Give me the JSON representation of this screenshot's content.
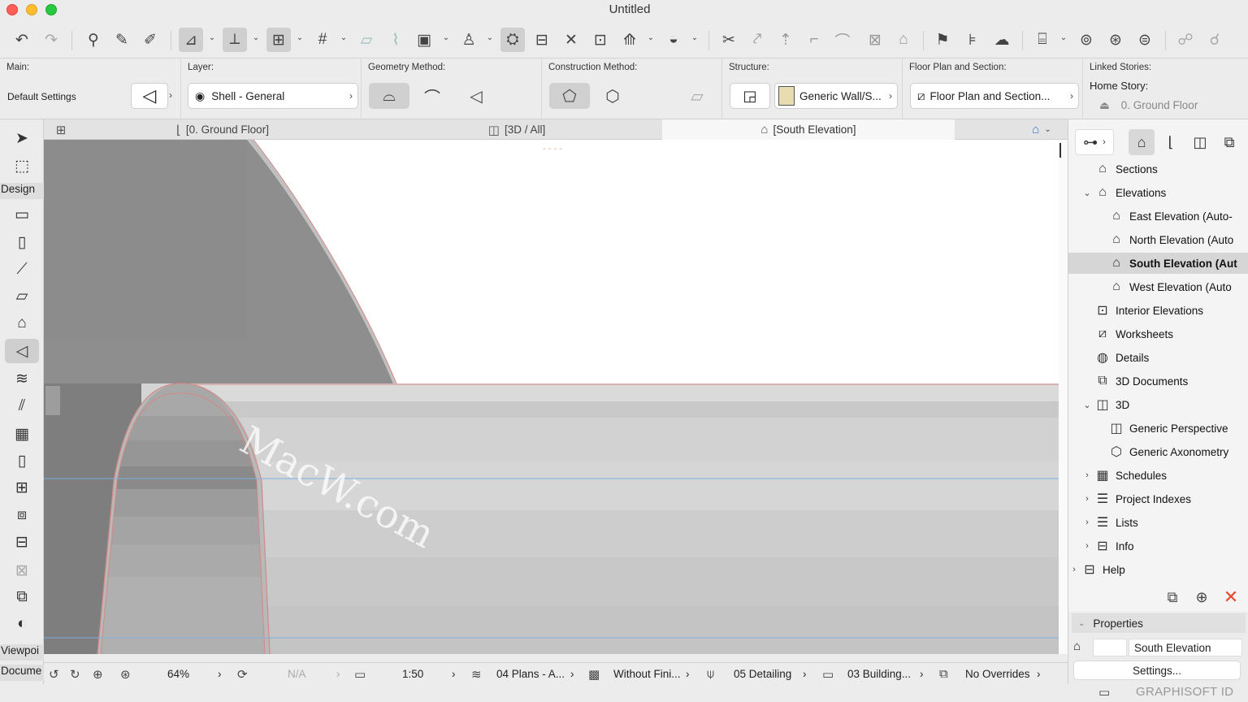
{
  "window": {
    "title": "Untitled"
  },
  "toolbar": {
    "icons": [
      "undo-icon",
      "redo-icon",
      "find-select-icon",
      "eyedropper-icon",
      "inject-icon",
      "guide-lines-icon",
      "snap-guides-icon",
      "grid-snap-icon",
      "grid-icon",
      "trace-icon",
      "split-icon",
      "layout-icon",
      "element-info-icon",
      "renovation-icon",
      "dimension-icon",
      "intersect-icon",
      "group-icon",
      "suspend-groups-icon",
      "solid-ops-icon",
      "cut-icon",
      "offset-icon",
      "elevate-icon",
      "corner-icon",
      "fillet-icon",
      "resize-icon",
      "roof-icon",
      "flag-icon",
      "teamwork-icon",
      "publish-icon",
      "reserve-icon",
      "send-receive-icon",
      "compare-icon",
      "issue-icon",
      "bim-icon",
      "cloud-icon"
    ]
  },
  "infobox": {
    "main_label": "Main:",
    "main_value": "Default Settings",
    "layer_label": "Layer:",
    "layer_value": "Shell - General",
    "geometry_label": "Geometry Method:",
    "construction_label": "Construction Method:",
    "structure_label": "Structure:",
    "structure_value": "Generic Wall/S...",
    "floorplan_label": "Floor Plan and Section:",
    "floorplan_value": "Floor Plan and Section...",
    "linked_label": "Linked Stories:",
    "home_story_label": "Home Story:",
    "home_story_value": "0. Ground Floor"
  },
  "toolbox": {
    "design_label": "Design",
    "viewpoint_label": "Viewpoi",
    "document_label": "Docume"
  },
  "tabs": [
    {
      "label": "[0. Ground Floor]"
    },
    {
      "label": "[3D / All]"
    },
    {
      "label": "[South Elevation]"
    }
  ],
  "navigator": {
    "items": [
      {
        "label": "Sections"
      },
      {
        "label": "Elevations"
      },
      {
        "label": "East Elevation (Auto-"
      },
      {
        "label": "North Elevation (Auto"
      },
      {
        "label": "South Elevation (Aut"
      },
      {
        "label": "West Elevation (Auto"
      },
      {
        "label": "Interior Elevations"
      },
      {
        "label": "Worksheets"
      },
      {
        "label": "Details"
      },
      {
        "label": "3D Documents"
      },
      {
        "label": "3D"
      },
      {
        "label": "Generic Perspective"
      },
      {
        "label": "Generic Axonometry"
      },
      {
        "label": "Schedules"
      },
      {
        "label": "Project Indexes"
      },
      {
        "label": "Lists"
      },
      {
        "label": "Info"
      },
      {
        "label": "Help"
      }
    ]
  },
  "properties": {
    "header": "Properties",
    "name_value": "South Elevation",
    "settings_label": "Settings..."
  },
  "statusbar": {
    "zoom": "64%",
    "orientation": "N/A",
    "scale": "1:50",
    "layer_combo": "04 Plans - A...",
    "model_view": "Without Fini...",
    "pen_set": "05 Detailing",
    "dimension": "03 Building...",
    "overrides": "No Overrides"
  },
  "brand": "GRAPHISOFT ID",
  "watermark": "MacW.com",
  "colors": {
    "accent": "#c8c8c8",
    "canvas_bg": "#ffffff",
    "dark_shell": "#8e8e8e",
    "light_shell": "#d6d6d6",
    "guide_line": "#7fb0e0",
    "close_red": "#e8462e"
  }
}
